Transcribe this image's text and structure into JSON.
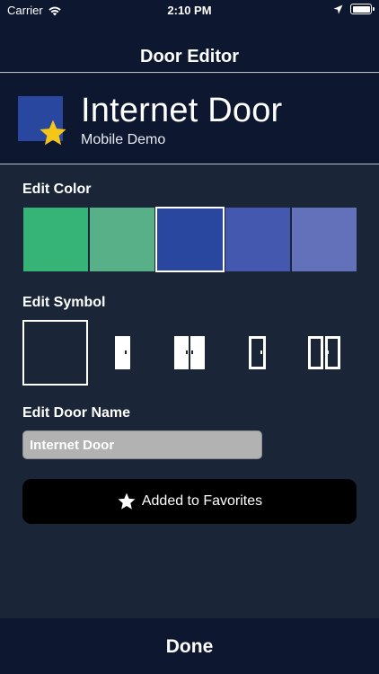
{
  "status_bar": {
    "carrier": "Carrier",
    "time": "2:10 PM"
  },
  "nav": {
    "title": "Door Editor"
  },
  "door": {
    "name": "Internet Door",
    "subtitle": "Mobile Demo",
    "color": "#2a47a0",
    "favorite": true
  },
  "color_section": {
    "label": "Edit Color",
    "swatches": [
      {
        "color": "#36b478",
        "selected": false
      },
      {
        "color": "#58b088",
        "selected": false
      },
      {
        "color": "#2a47a0",
        "selected": true
      },
      {
        "color": "#4558b0",
        "selected": false
      },
      {
        "color": "#6371ba",
        "selected": false
      }
    ]
  },
  "symbol_section": {
    "label": "Edit Symbol",
    "symbols": [
      {
        "icon": "empty-symbol-icon",
        "selected": true
      },
      {
        "icon": "single-door-icon",
        "selected": false
      },
      {
        "icon": "double-door-icon",
        "selected": false
      },
      {
        "icon": "single-glass-door-icon",
        "selected": false
      },
      {
        "icon": "double-glass-door-icon",
        "selected": false
      }
    ]
  },
  "name_section": {
    "label": "Edit Door Name",
    "value": "Internet Door"
  },
  "favorite_button": {
    "label": "Added to Favorites",
    "icon": "star-icon"
  },
  "done_bar": {
    "label": "Done"
  },
  "colors": {
    "accent_star": "#f5c518",
    "background": "#1b2538",
    "bars": "#0d1730"
  }
}
